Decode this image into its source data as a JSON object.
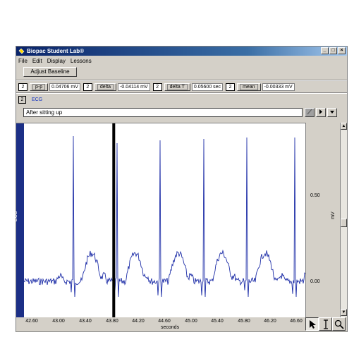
{
  "window": {
    "title": "Biopac Student Lab®",
    "controls": {
      "minimize": "_",
      "maximize": "□",
      "close": "×"
    }
  },
  "menu": [
    "File",
    "Edit",
    "Display",
    "Lessons"
  ],
  "toolbar": {
    "adjust_baseline_label": "Adjust Baseline"
  },
  "measurements": [
    {
      "channel": "2",
      "label": "p-p",
      "value": "0.04706 mV"
    },
    {
      "channel": "2",
      "label": "delta",
      "value": "-0.04114 mV"
    },
    {
      "channel": "2",
      "label": "delta T",
      "value": "0.05600 sec"
    },
    {
      "channel": "2",
      "label": "mean",
      "value": "-0.00333 mV"
    }
  ],
  "channel": {
    "number": "2",
    "name": "ECG"
  },
  "journal": {
    "text": "After sitting up"
  },
  "plot": {
    "channel_label": "ECG",
    "y_ticks": [
      "0.50",
      "0.00"
    ],
    "y_unit": "mV",
    "x_ticks": [
      "42.60",
      "43.00",
      "43.40",
      "43.80",
      "44.20",
      "44.60",
      "45.00",
      "45.40",
      "45.80",
      "46.20",
      "46.60"
    ],
    "x_label": "seconds",
    "trace_color": "#1f2fa8",
    "strip_color": "#1c2f86",
    "cursor_time_s": 43.84
  },
  "tools": {
    "arrow": "arrow-icon",
    "ibeam": "i-beam-icon",
    "zoom": "magnifier-icon"
  }
}
